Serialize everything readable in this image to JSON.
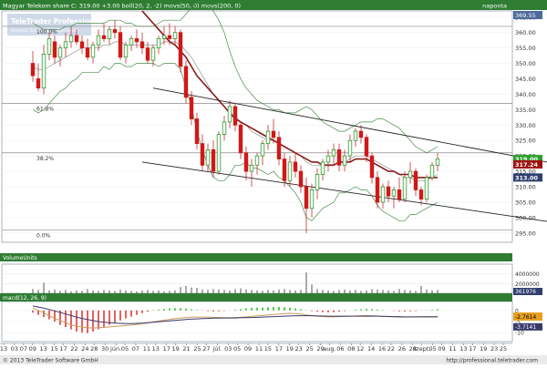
{
  "header": {
    "title": "Magyar Telekom share  C: 319.00  +3.00  boll(20, 2, -2)  movs(50, 0)  movs(200, 0)",
    "period": "naponta"
  },
  "watermark": {
    "brand": "TeleTrader Professional",
    "tagline": "Analysis Technologies Worldwide"
  },
  "footer": {
    "copyright": "© 2013 TeleTrader Software GmbH",
    "url": "http://professional.teletrader.com"
  },
  "chart_data": [
    {
      "type": "candlestick",
      "name": "price",
      "ylim": [
        292,
        367
      ],
      "y_ticks": [
        295,
        300,
        305,
        310,
        315,
        320,
        325,
        330,
        335,
        340,
        345,
        350,
        355,
        360,
        365
      ],
      "ohlc": [
        [
          350,
          354,
          344,
          346
        ],
        [
          345,
          350,
          341,
          342
        ],
        [
          342,
          356,
          340,
          353
        ],
        [
          353,
          360,
          351,
          358
        ],
        [
          357,
          359,
          350,
          352
        ],
        [
          352,
          356,
          349,
          355
        ],
        [
          355,
          360,
          352,
          357
        ],
        [
          357,
          362,
          355,
          359
        ],
        [
          359,
          361,
          356,
          357
        ],
        [
          357,
          359,
          353,
          355
        ],
        [
          355,
          358,
          351,
          352
        ],
        [
          352,
          357,
          350,
          356
        ],
        [
          356,
          361,
          354,
          359
        ],
        [
          359,
          363,
          357,
          358
        ],
        [
          358,
          362,
          356,
          361
        ],
        [
          361,
          364,
          358,
          360
        ],
        [
          360,
          362,
          351,
          352
        ],
        [
          352,
          357,
          350,
          356
        ],
        [
          356,
          359,
          354,
          358
        ],
        [
          358,
          361,
          355,
          357
        ],
        [
          357,
          360,
          353,
          355
        ],
        [
          355,
          357,
          350,
          351
        ],
        [
          351,
          356,
          349,
          355
        ],
        [
          355,
          359,
          353,
          358
        ],
        [
          358,
          362,
          356,
          359
        ],
        [
          359,
          363,
          356,
          358
        ],
        [
          358,
          362,
          356,
          360
        ],
        [
          360,
          361,
          347,
          349
        ],
        [
          349,
          351,
          337,
          339
        ],
        [
          339,
          341,
          330,
          332
        ],
        [
          332,
          334,
          322,
          324
        ],
        [
          324,
          327,
          315,
          317
        ],
        [
          317,
          324,
          315,
          322
        ],
        [
          322,
          325,
          313,
          315
        ],
        [
          315,
          328,
          314,
          327
        ],
        [
          327,
          333,
          325,
          331
        ],
        [
          331,
          338,
          329,
          336
        ],
        [
          336,
          337,
          328,
          330
        ],
        [
          330,
          331,
          319,
          321
        ],
        [
          321,
          323,
          312,
          315
        ],
        [
          315,
          319,
          310,
          317
        ],
        [
          317,
          321,
          314,
          320
        ],
        [
          320,
          325,
          317,
          324
        ],
        [
          324,
          330,
          322,
          328
        ],
        [
          328,
          332,
          324,
          326
        ],
        [
          326,
          328,
          317,
          319
        ],
        [
          319,
          321,
          310,
          312
        ],
        [
          312,
          320,
          310,
          318
        ],
        [
          318,
          321,
          313,
          315
        ],
        [
          315,
          317,
          308,
          310
        ],
        [
          310,
          313,
          295,
          303
        ],
        [
          303,
          311,
          300,
          309
        ],
        [
          309,
          316,
          306,
          314
        ],
        [
          314,
          319,
          312,
          318
        ],
        [
          318,
          322,
          315,
          320
        ],
        [
          320,
          324,
          317,
          322
        ],
        [
          322,
          324,
          315,
          317
        ],
        [
          317,
          322,
          315,
          320
        ],
        [
          320,
          327,
          318,
          325
        ],
        [
          325,
          329,
          323,
          328
        ],
        [
          328,
          330,
          324,
          326
        ],
        [
          326,
          327,
          318,
          320
        ],
        [
          320,
          321,
          311,
          313
        ],
        [
          313,
          315,
          303,
          305
        ],
        [
          305,
          311,
          303,
          310
        ],
        [
          310,
          312,
          305,
          307
        ],
        [
          307,
          310,
          303,
          309
        ],
        [
          309,
          313,
          305,
          306
        ],
        [
          306,
          315,
          305,
          313
        ],
        [
          313,
          318,
          311,
          315
        ],
        [
          315,
          316,
          307,
          309
        ],
        [
          309,
          310,
          304,
          306
        ],
        [
          306,
          314,
          305,
          313
        ],
        [
          313,
          318,
          312,
          317
        ],
        [
          317,
          321,
          315,
          319
        ]
      ],
      "series": [
        {
          "values": [
            349,
            348,
            348,
            349,
            350,
            351,
            352,
            353,
            354,
            355,
            355,
            355,
            355,
            356,
            356,
            357,
            357,
            356,
            356,
            356,
            356,
            356,
            356,
            356,
            357,
            357,
            357,
            356,
            354,
            352,
            349,
            346,
            343,
            340,
            338,
            336,
            334,
            333,
            331,
            330,
            328,
            327,
            326,
            325,
            325,
            324,
            323,
            322,
            321,
            320,
            318,
            317,
            317,
            317,
            317,
            317,
            318,
            318,
            319,
            320,
            320,
            320,
            319,
            318,
            317,
            316,
            315,
            314,
            313,
            313,
            312,
            312,
            312,
            313,
            314
          ],
          "color": "#909090"
        },
        {
          "values": [
            363,
            362,
            361,
            361,
            361,
            361,
            362,
            362,
            363,
            363,
            363,
            363,
            363,
            363,
            364,
            364,
            364,
            363,
            363,
            362,
            362,
            362,
            362,
            363,
            364,
            364,
            364,
            364,
            366,
            368,
            370,
            370,
            369,
            367,
            364,
            360,
            354,
            349,
            345,
            342,
            340,
            338,
            337,
            336,
            335,
            335,
            334,
            334,
            334,
            335,
            336,
            335,
            333,
            331,
            330,
            329,
            328,
            328,
            329,
            330,
            331,
            331,
            331,
            332,
            332,
            331,
            330,
            329,
            327,
            325,
            323,
            322,
            321,
            322,
            323
          ],
          "color": "#4a8a4a"
        },
        {
          "values": [
            335,
            334,
            335,
            337,
            339,
            341,
            342,
            344,
            345,
            347,
            347,
            347,
            347,
            349,
            348,
            350,
            350,
            349,
            349,
            350,
            350,
            350,
            350,
            349,
            350,
            350,
            350,
            348,
            342,
            336,
            328,
            322,
            317,
            313,
            312,
            312,
            314,
            317,
            317,
            318,
            316,
            316,
            315,
            314,
            315,
            313,
            312,
            310,
            308,
            305,
            300,
            299,
            301,
            303,
            304,
            305,
            308,
            308,
            309,
            310,
            309,
            309,
            307,
            304,
            302,
            301,
            300,
            299,
            299,
            301,
            301,
            302,
            303,
            304,
            305
          ],
          "color": "#4a8a4a"
        },
        {
          "values": [
            null,
            null,
            null,
            null,
            null,
            null,
            null,
            null,
            null,
            null,
            null,
            null,
            null,
            null,
            null,
            null,
            null,
            null,
            null,
            null,
            367,
            365,
            363,
            361,
            359,
            357,
            356,
            354,
            352,
            349,
            346,
            344,
            342,
            340,
            338,
            336,
            334,
            332,
            331,
            330,
            329,
            328,
            327,
            326,
            325,
            324,
            323,
            322,
            321,
            320,
            319,
            318,
            318,
            317,
            317,
            317,
            318,
            318,
            318,
            319,
            319,
            319,
            318,
            317,
            316,
            315,
            315,
            314,
            314,
            314,
            313,
            313,
            313,
            313,
            313
          ],
          "color": "#8b1a1a"
        }
      ],
      "channel_lines": [
        {
          "from": [
            22,
            342
          ],
          "to": [
            97,
            317
          ]
        },
        {
          "from": [
            20,
            318
          ],
          "to": [
            97,
            298
          ]
        }
      ],
      "fibonacci": [
        {
          "label": "100.0%",
          "value": 362
        },
        {
          "label": "61.8%",
          "value": 337
        },
        {
          "label": "38.2%",
          "value": 321
        },
        {
          "label": "0.0%",
          "value": 296
        }
      ],
      "price_tags": [
        {
          "text": "319.00",
          "value": 319,
          "color": "#2ca02c"
        },
        {
          "text": "317.24",
          "value": 317.24,
          "color": "#a01010"
        },
        {
          "text": "313.00",
          "value": 313,
          "color": "#2f3f6f"
        }
      ],
      "axis_top_label": "369.55"
    },
    {
      "type": "bar",
      "name": "volume",
      "title": "VolumeUnits",
      "ylim": [
        0,
        6000000
      ],
      "y_ticks": [
        2000000,
        4000000
      ],
      "y_tick_labels": [
        "2000000",
        "4000000"
      ],
      "current_label": "361976",
      "values": [
        900000,
        700000,
        2200000,
        600000,
        800000,
        500000,
        700000,
        400000,
        600000,
        500000,
        900000,
        600000,
        500000,
        700000,
        600000,
        500000,
        800000,
        600000,
        500000,
        400000,
        600000,
        700000,
        500000,
        600000,
        400000,
        500000,
        600000,
        1300000,
        1500000,
        1200000,
        1100000,
        800000,
        700000,
        900000,
        800000,
        700000,
        600000,
        900000,
        1000000,
        800000,
        700000,
        600000,
        500000,
        700000,
        600000,
        800000,
        900000,
        700000,
        600000,
        700000,
        4300000,
        1800000,
        900000,
        700000,
        600000,
        500000,
        700000,
        800000,
        600000,
        700000,
        500000,
        600000,
        900000,
        800000,
        700000,
        600000,
        500000,
        900000,
        700000,
        600000,
        500000,
        1500000,
        800000,
        600000,
        700000
      ]
    },
    {
      "type": "bar",
      "name": "macd",
      "title": "macd(12, 26, 9)",
      "ylim": [
        -14,
        4
      ],
      "y_ticks": [
        -10,
        -5,
        0
      ],
      "y_tick_labels": [
        "-10",
        "-5",
        "0"
      ],
      "current_label": "-2.7614",
      "current_signal_label": "-3.7141",
      "histogram": [
        -1.0,
        -2.0,
        -3.0,
        -4.0,
        -5.0,
        -6.5,
        -7.5,
        -8.5,
        -9.5,
        -10.0,
        -10.2,
        -9.5,
        -8.5,
        -7.5,
        -6.5,
        -5.5,
        -4.5,
        -3.6,
        -2.8,
        -2.0,
        -1.2,
        -0.6,
        -0.1,
        0.4,
        0.7,
        0.9,
        1.0,
        1.0,
        0.8,
        0.5,
        0.2,
        -0.1,
        -0.3,
        -0.5,
        -0.4,
        -0.2,
        0.0,
        0.3,
        0.6,
        0.9,
        1.1,
        1.2,
        1.3,
        1.4,
        1.5,
        1.5,
        1.4,
        1.2,
        0.9,
        0.5,
        0.1,
        -0.3,
        -0.6,
        -0.8,
        -0.9,
        -0.8,
        -0.6,
        -0.3,
        0.0,
        0.3,
        0.5,
        0.7,
        0.6,
        0.4,
        0.2,
        0.0,
        -0.2,
        -0.4,
        -0.5,
        -0.4,
        -0.3,
        -0.1,
        0.1,
        0.3,
        0.5
      ],
      "macd_line": [
        1.0,
        0.0,
        -1.0,
        -2.5,
        -3.5,
        -4.5,
        -5.5,
        -6.5,
        -7.0,
        -7.5,
        -7.8,
        -7.9,
        -7.8,
        -7.6,
        -7.4,
        -7.2,
        -7.0,
        -6.8,
        -6.6,
        -6.3,
        -6.0,
        -5.6,
        -5.2,
        -4.8,
        -4.4,
        -4.0,
        -3.7,
        -3.4,
        -3.2,
        -3.0,
        -3.0,
        -3.0,
        -3.0,
        -3.1,
        -3.2,
        -3.3,
        -3.3,
        -3.2,
        -3.1,
        -2.9,
        -2.7,
        -2.5,
        -2.3,
        -2.0,
        -1.8,
        -1.6,
        -1.4,
        -1.3,
        -1.4,
        -1.6,
        -2.0,
        -2.3,
        -2.6,
        -2.8,
        -2.9,
        -2.9,
        -2.8,
        -2.7,
        -2.6,
        -2.5,
        -2.4,
        -2.3,
        -2.4,
        -2.5,
        -2.6,
        -2.8,
        -2.9,
        -3.0,
        -3.0,
        -2.9,
        -2.9,
        -2.8,
        -2.8,
        -2.8,
        -2.76
      ],
      "signal_line": [
        2.0,
        1.5,
        1.0,
        0.4,
        -0.2,
        -0.9,
        -1.6,
        -2.3,
        -3.0,
        -3.6,
        -4.1,
        -4.6,
        -5.0,
        -5.3,
        -5.5,
        -5.7,
        -5.8,
        -5.9,
        -5.9,
        -5.8,
        -5.7,
        -5.5,
        -5.3,
        -5.1,
        -4.9,
        -4.7,
        -4.5,
        -4.3,
        -4.1,
        -3.9,
        -3.8,
        -3.7,
        -3.6,
        -3.5,
        -3.5,
        -3.4,
        -3.4,
        -3.4,
        -3.3,
        -3.3,
        -3.2,
        -3.1,
        -3.0,
        -2.9,
        -2.8,
        -2.7,
        -2.6,
        -2.5,
        -2.4,
        -2.4,
        -2.4,
        -2.4,
        -2.5,
        -2.5,
        -2.6,
        -2.6,
        -2.6,
        -2.6,
        -2.6,
        -2.6,
        -2.6,
        -2.6,
        -2.6,
        -2.6,
        -2.7,
        -2.7,
        -2.8,
        -2.8,
        -2.9,
        -2.9,
        -2.9,
        -2.9,
        -2.9,
        -2.9,
        -2.9
      ],
      "colors": {
        "macd": "#c89b5c",
        "signal": "#3a3a6a",
        "positive": "#3fbf3f",
        "negative": "#e05050"
      }
    }
  ],
  "x_axis": {
    "labels": [
      "13",
      "03",
      "07",
      "09",
      "13",
      "15",
      "17",
      "22",
      "24",
      "28",
      "30",
      "jún.",
      "05",
      "07",
      "11",
      "13",
      "17",
      "19",
      "21",
      "25",
      "27",
      "júl.",
      "03",
      "05",
      "09",
      "11",
      "15",
      "17",
      "19",
      "23",
      "25",
      "29",
      "aug.",
      "06",
      "08",
      "12",
      "14",
      "16",
      "22",
      "26",
      "28",
      "szept.",
      "05",
      "09",
      "11",
      "13",
      "17",
      "19",
      "23",
      "25"
    ],
    "positions": [
      1,
      7,
      12,
      17,
      23,
      29,
      34,
      40,
      46,
      51,
      57,
      63,
      68,
      74,
      80,
      85,
      91,
      96,
      102,
      108,
      113,
      119,
      125,
      130,
      136,
      142,
      147,
      153,
      159,
      164,
      170,
      176,
      181,
      187,
      193,
      198,
      204,
      210,
      215,
      221,
      227,
      232,
      238,
      243,
      249,
      255,
      260,
      266,
      272,
      277
    ],
    "slots": 282
  }
}
